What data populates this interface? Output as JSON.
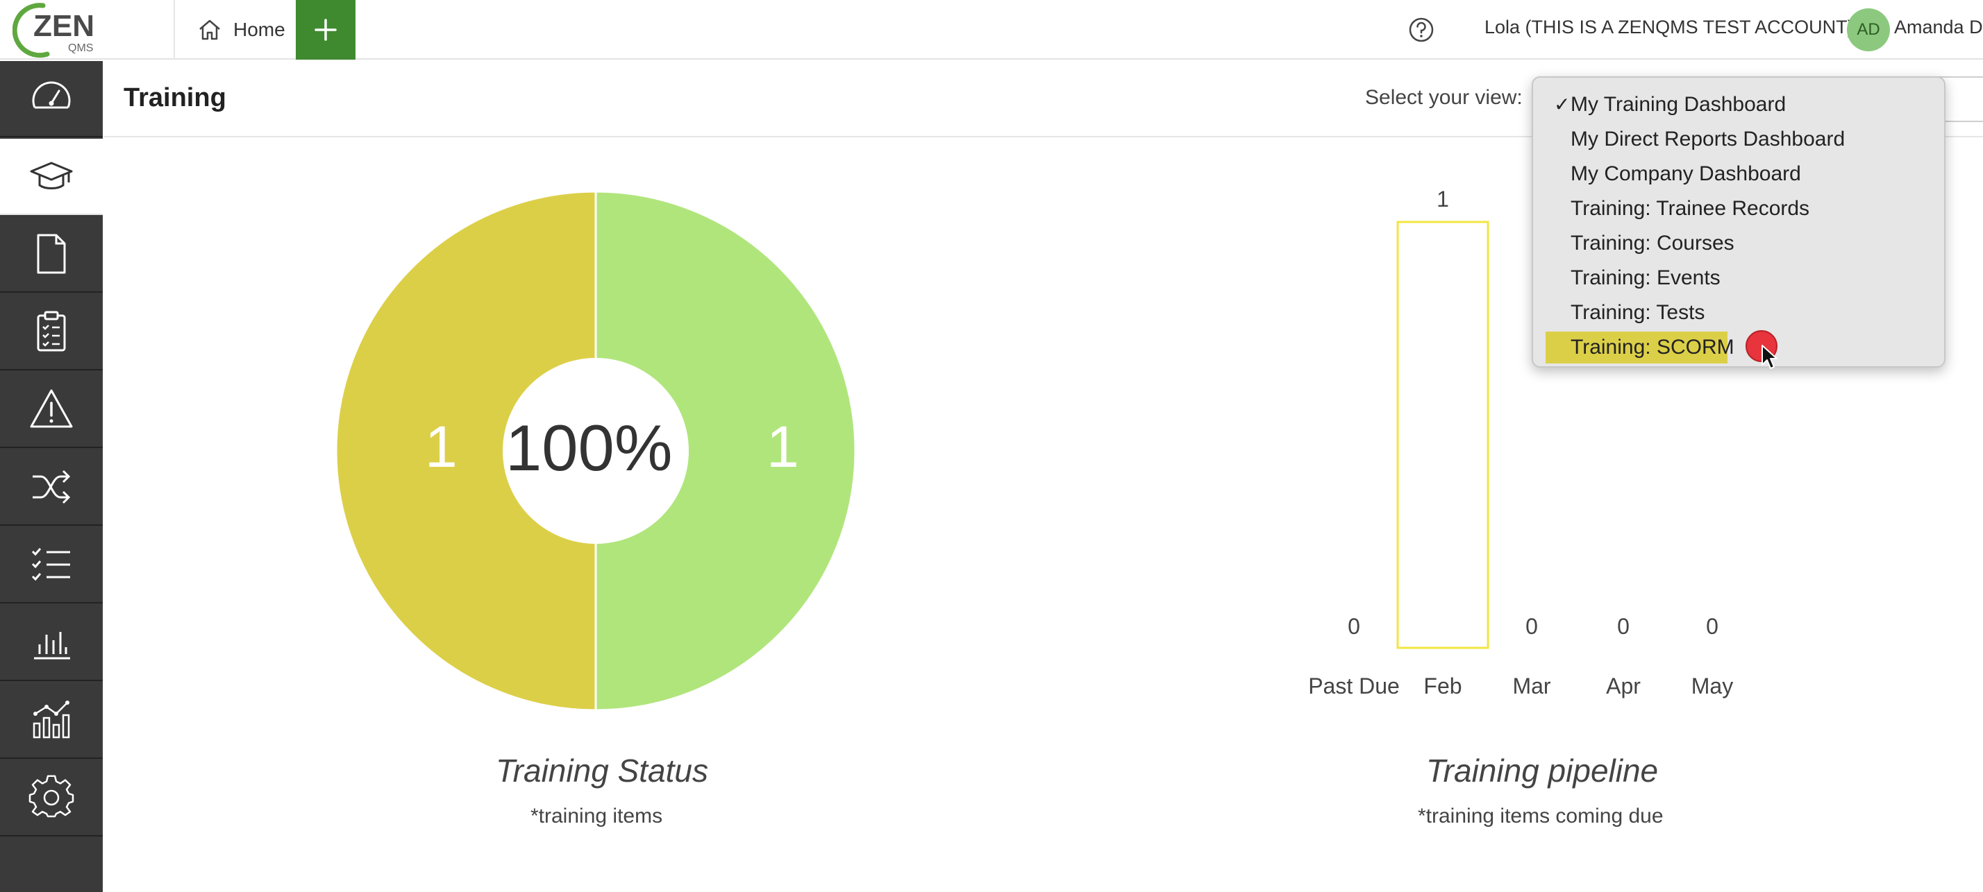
{
  "topbar": {
    "logo_text": "ZEN",
    "logo_sub": "QMS",
    "home_label": "Home",
    "add_icon": "plus-icon",
    "help_icon": "question-circle-icon",
    "account_name": "Lola (THIS IS A ZENQMS TEST ACCOUNT)",
    "avatar_initials": "AD",
    "user_name": "Amanda D"
  },
  "sidebar": {
    "items": [
      {
        "icon": "dashboard-gauge-icon",
        "active": false
      },
      {
        "icon": "graduation-cap-icon",
        "active": true
      },
      {
        "icon": "document-icon",
        "active": false
      },
      {
        "icon": "clipboard-checklist-icon",
        "active": false
      },
      {
        "icon": "warning-triangle-icon",
        "active": false
      },
      {
        "icon": "shuffle-icon",
        "active": false
      },
      {
        "icon": "checklist-icon",
        "active": false
      },
      {
        "icon": "bar-chart-icon",
        "active": false
      },
      {
        "icon": "line-bar-chart-icon",
        "active": false
      },
      {
        "icon": "gear-icon",
        "active": false
      }
    ]
  },
  "header": {
    "title": "Training",
    "view_label": "Select your view:"
  },
  "dropdown": {
    "options": [
      {
        "label": "My Training Dashboard",
        "checked": true
      },
      {
        "label": "My Direct Reports Dashboard",
        "checked": false
      },
      {
        "label": "My Company Dashboard",
        "checked": false
      },
      {
        "label": "Training: Trainee Records",
        "checked": false
      },
      {
        "label": "Training: Courses",
        "checked": false
      },
      {
        "label": "Training: Events",
        "checked": false
      },
      {
        "label": "Training: Tests",
        "checked": false
      },
      {
        "label": "Training: SCORM",
        "checked": false,
        "hovered": true
      }
    ],
    "check_mark": "✓",
    "highlight_color": "#dccf48"
  },
  "chart_data": [
    {
      "type": "pie",
      "title": "Training Status",
      "subtitle": "*training items",
      "center_label": "100%",
      "slices": [
        {
          "value": 1,
          "color": "#dccf48"
        },
        {
          "value": 1,
          "color": "#b0e57c"
        }
      ],
      "slice_labels": [
        "1",
        "1"
      ]
    },
    {
      "type": "bar",
      "title": "Training pipeline",
      "subtitle": "*training items coming due",
      "categories": [
        "Past Due",
        "Feb",
        "Mar",
        "Apr",
        "May"
      ],
      "values": [
        0,
        1,
        0,
        0,
        0
      ],
      "value_labels": [
        "0",
        "1",
        "0",
        "0",
        "0"
      ],
      "bar_outline_color": "#f2e640"
    }
  ],
  "colors": {
    "sidebar_bg": "#3a3a3a",
    "brand_green": "#3f8a2f",
    "donut_yellow": "#dccf48",
    "donut_green": "#b0e57c"
  }
}
